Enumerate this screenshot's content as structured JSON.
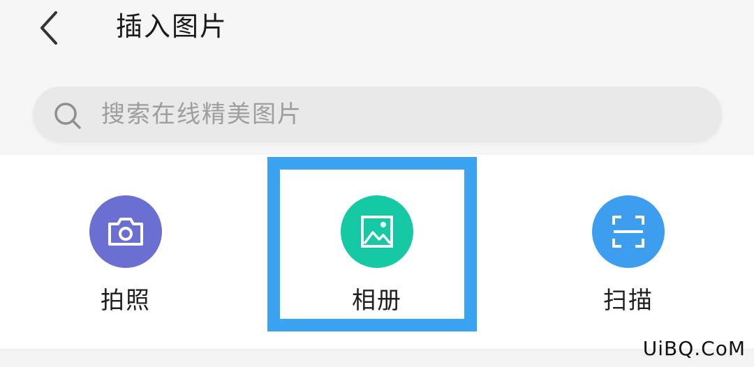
{
  "header": {
    "back_icon": "chevron-left-icon",
    "title": "插入图片"
  },
  "search": {
    "icon": "search-icon",
    "placeholder": "搜索在线精美图片",
    "value": ""
  },
  "options": [
    {
      "label": "拍照",
      "icon": "camera-icon",
      "color": "#6c6fd2"
    },
    {
      "label": "相册",
      "icon": "image-icon",
      "color": "#14c9a3"
    },
    {
      "label": "扫描",
      "icon": "scan-icon",
      "color": "#3d9ef0"
    }
  ],
  "highlight": {
    "color": "#3aa4f2",
    "target": "相册"
  },
  "watermark": "UiBQ.CoM"
}
